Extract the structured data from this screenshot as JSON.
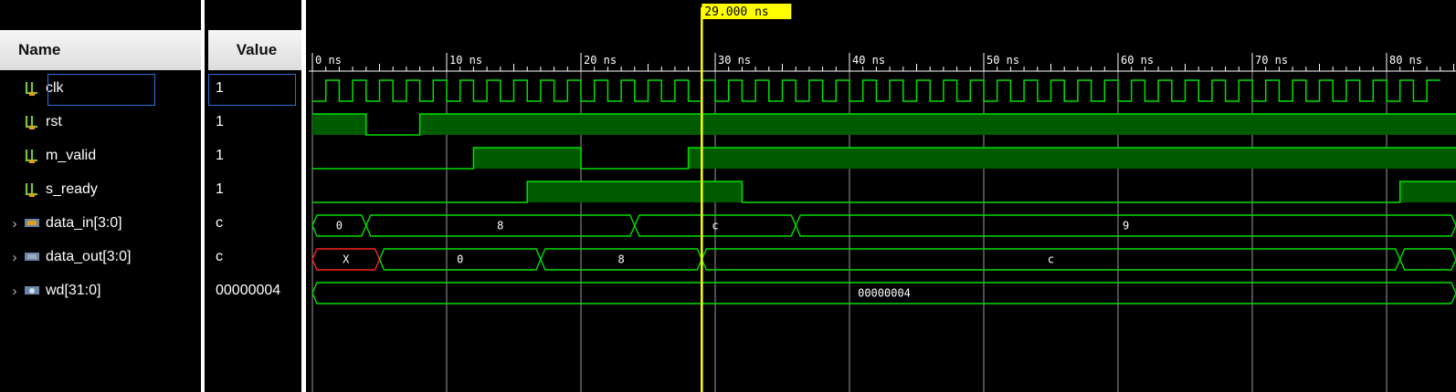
{
  "columns": {
    "name": "Name",
    "value": "Value"
  },
  "cursor": {
    "label": "29.000 ns",
    "time": 29
  },
  "timeline": {
    "start": 0,
    "end": 82,
    "major_step": 10,
    "minor_per_major": 10,
    "tick_labels": [
      "0 ns",
      "10 ns",
      "20 ns",
      "30 ns",
      "40 ns",
      "50 ns",
      "60 ns",
      "70 ns",
      "80 ns"
    ]
  },
  "signals": [
    {
      "name": "clk",
      "value": "1",
      "kind": "bit",
      "icon": "bit-signal-icon",
      "expandable": false,
      "selected": true
    },
    {
      "name": "rst",
      "value": "1",
      "kind": "bit",
      "icon": "bit-signal-icon",
      "expandable": false
    },
    {
      "name": "m_valid",
      "value": "1",
      "kind": "bit",
      "icon": "bit-signal-icon",
      "expandable": false
    },
    {
      "name": "s_ready",
      "value": "1",
      "kind": "bit",
      "icon": "bit-signal-icon",
      "expandable": false
    },
    {
      "name": "data_in[3:0]",
      "value": "c",
      "kind": "bus",
      "icon": "bus-input-icon",
      "expandable": true
    },
    {
      "name": "data_out[3:0]",
      "value": "c",
      "kind": "bus",
      "icon": "bus-output-icon",
      "expandable": true
    },
    {
      "name": "wd[31:0]",
      "value": "00000004",
      "kind": "bus",
      "icon": "bus-internal-icon",
      "expandable": true
    }
  ],
  "waveforms": {
    "clk": {
      "period": 2,
      "first_rise": 1
    },
    "rst": [
      [
        0,
        1
      ],
      [
        4,
        0
      ],
      [
        8,
        1
      ]
    ],
    "m_valid": [
      [
        0,
        0
      ],
      [
        12,
        1
      ],
      [
        20,
        0
      ],
      [
        28,
        1
      ]
    ],
    "s_ready": [
      [
        0,
        0
      ],
      [
        16,
        1
      ],
      [
        32,
        0
      ],
      [
        81,
        1
      ]
    ],
    "data_in[3:0]": [
      [
        0,
        "0"
      ],
      [
        4,
        "8"
      ],
      [
        24,
        "c"
      ],
      [
        36,
        "9"
      ]
    ],
    "data_out[3:0]": [
      [
        0,
        "X"
      ],
      [
        5,
        "0"
      ],
      [
        17,
        "8"
      ],
      [
        29,
        "c"
      ],
      [
        81,
        ""
      ]
    ],
    "wd[31:0]": [
      [
        0,
        "00000004"
      ]
    ]
  },
  "colors": {
    "wave": "#00e000",
    "fill": "#005a00",
    "unknown": "#ff2020",
    "cursor": "#ffff00",
    "grid": "#9a9a9a"
  }
}
